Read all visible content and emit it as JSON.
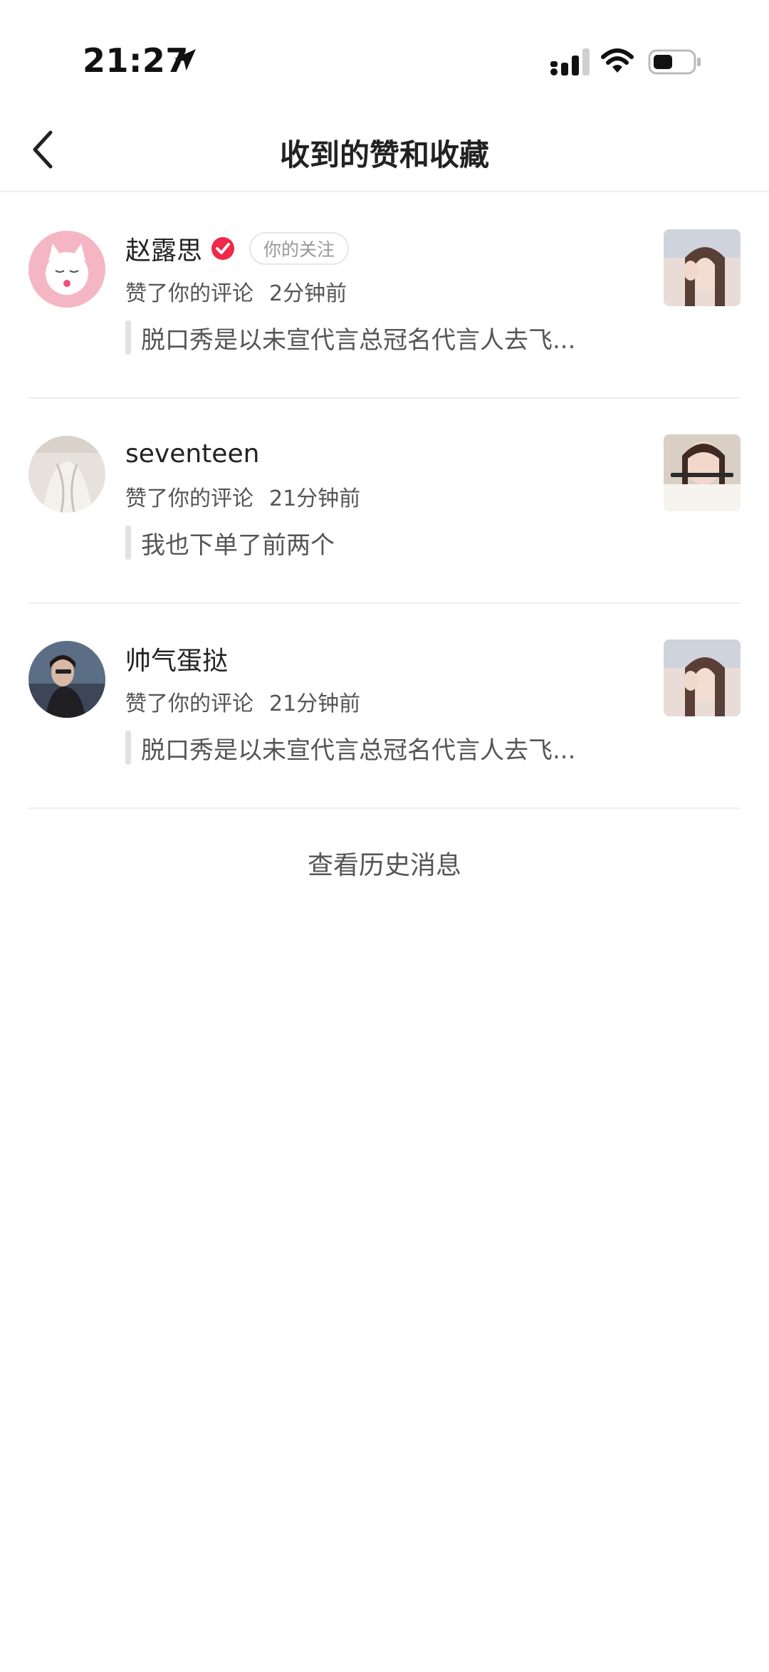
{
  "status_bar": {
    "time": "21:27",
    "icons": [
      "location-arrow-icon",
      "cellular-signal-icon",
      "wifi-icon",
      "battery-icon"
    ]
  },
  "nav": {
    "title": "收到的赞和收藏",
    "back_icon": "chevron-left-icon"
  },
  "notifications": [
    {
      "username": "赵露思",
      "verified": true,
      "follow_tag": "你的关注",
      "action": "赞了你的评论",
      "time": "2分钟前",
      "quote": "脱口秀是以未宣代言总冠名代言人去飞..."
    },
    {
      "username": "seventeen",
      "verified": false,
      "follow_tag": "",
      "action": "赞了你的评论",
      "time": "21分钟前",
      "quote": "我也下单了前两个"
    },
    {
      "username": "帅气蛋挞",
      "verified": false,
      "follow_tag": "",
      "action": "赞了你的评论",
      "time": "21分钟前",
      "quote": "脱口秀是以未宣代言总冠名代言人去飞..."
    }
  ],
  "history_link": "查看历史消息",
  "colors": {
    "verified_badge": "#f0284a",
    "divider": "#eeeeee",
    "secondary_text": "#555555"
  }
}
